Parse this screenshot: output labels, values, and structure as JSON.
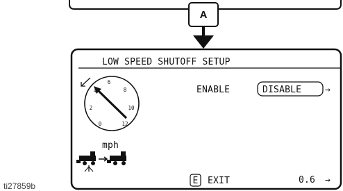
{
  "callout": {
    "label": "A"
  },
  "screen": {
    "title": "LOW SPEED SHUTOFF SETUP",
    "enable_label": "ENABLE",
    "mode_value": "DISABLE",
    "exit_key": "E",
    "exit_label": "EXIT",
    "speed_value": "0.6",
    "arrow_right": "→",
    "speed_unit": "mph",
    "gauge_numbers": [
      "0",
      "2",
      "4",
      "6",
      "8",
      "10",
      "12"
    ],
    "gauge_needle_value": 3.6,
    "icons": [
      "speedometer-icon",
      "low-speed-arrow-icon",
      "sprayer-to-sprayer-icon"
    ]
  },
  "figure_ref": "ti27859b"
}
